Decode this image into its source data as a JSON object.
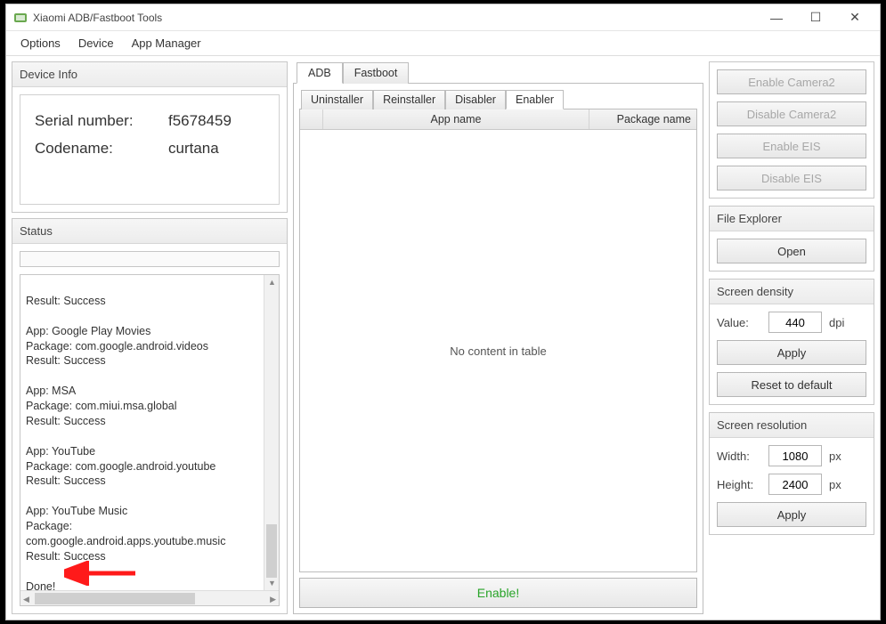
{
  "window": {
    "title": "Xiaomi ADB/Fastboot Tools"
  },
  "menu": {
    "items": [
      "Options",
      "Device",
      "App Manager"
    ]
  },
  "device_info": {
    "header": "Device Info",
    "serial_label": "Serial number:",
    "serial_value": "f5678459",
    "codename_label": "Codename:",
    "codename_value": "curtana"
  },
  "status": {
    "header": "Status",
    "log": "Result: Success\n\nApp: Google Play Movies\nPackage: com.google.android.videos\nResult: Success\n\nApp: MSA\nPackage: com.miui.msa.global\nResult: Success\n\nApp: YouTube\nPackage: com.google.android.youtube\nResult: Success\n\nApp: YouTube Music\nPackage: com.google.android.apps.youtube.music\nResult: Success\n\nDone!"
  },
  "main": {
    "top_tabs": {
      "adb": "ADB",
      "fastboot": "Fastboot"
    },
    "sub_tabs": {
      "uninstaller": "Uninstaller",
      "reinstaller": "Reinstaller",
      "disabler": "Disabler",
      "enabler": "Enabler"
    },
    "table": {
      "col_app": "App name",
      "col_pkg": "Package name",
      "empty": "No content in table"
    },
    "enable_btn": "Enable!"
  },
  "right": {
    "camera": {
      "enable_cam": "Enable Camera2",
      "disable_cam": "Disable Camera2",
      "enable_eis": "Enable EIS",
      "disable_eis": "Disable EIS"
    },
    "file_explorer": {
      "header": "File Explorer",
      "open": "Open"
    },
    "density": {
      "header": "Screen density",
      "value_label": "Value:",
      "value": "440",
      "unit": "dpi",
      "apply": "Apply",
      "reset": "Reset to default"
    },
    "resolution": {
      "header": "Screen resolution",
      "width_label": "Width:",
      "width": "1080",
      "height_label": "Height:",
      "height": "2400",
      "unit": "px",
      "apply": "Apply"
    }
  }
}
